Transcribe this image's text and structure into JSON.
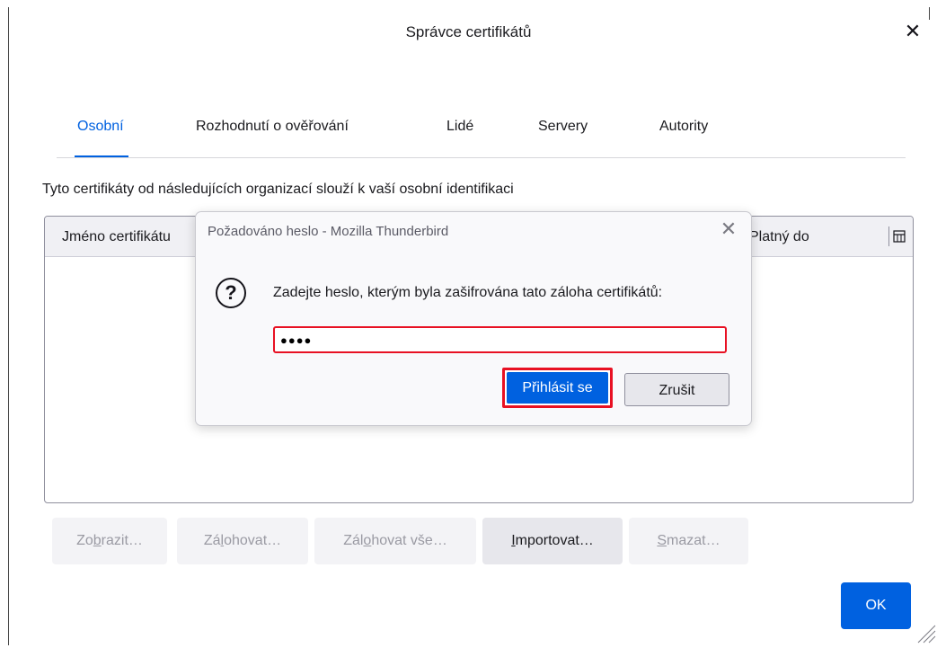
{
  "window": {
    "title": "Správce certifikátů",
    "close_symbol": "✕"
  },
  "tabs": [
    {
      "label": "Osobní",
      "active": true
    },
    {
      "label": "Rozhodnutí o ověřování",
      "active": false
    },
    {
      "label": "Lidé",
      "active": false
    },
    {
      "label": "Servery",
      "active": false
    },
    {
      "label": "Autority",
      "active": false
    }
  ],
  "description": "Tyto certifikáty od následujících organizací slouží k vaší osobní identifikaci",
  "table": {
    "columns": [
      "Jméno certifikátu",
      "Platný do"
    ],
    "rows": []
  },
  "buttons": {
    "view": {
      "before": "Zo",
      "key": "b",
      "after": "razit…"
    },
    "backup": {
      "before": "Zá",
      "key": "l",
      "after": "ohovat…"
    },
    "backup_all": {
      "before": "Zál",
      "key": "o",
      "after": "hovat vše…"
    },
    "import": {
      "before": "",
      "key": "I",
      "after": "mportovat…"
    },
    "delete": {
      "before": "",
      "key": "S",
      "after": "mazat…"
    },
    "ok": "OK"
  },
  "modal": {
    "title": "Požadováno heslo - Mozilla Thunderbird",
    "close_symbol": "✕",
    "icon": "question-icon",
    "icon_symbol": "?",
    "prompt": "Zadejte heslo, kterým byla zašifrována tato záloha certifikátů:",
    "password_masked": "●●●●",
    "login_label": "Přihlásit se",
    "cancel_label": "Zrušit"
  },
  "colors": {
    "accent": "#0061e0",
    "highlight": "#e81123"
  }
}
